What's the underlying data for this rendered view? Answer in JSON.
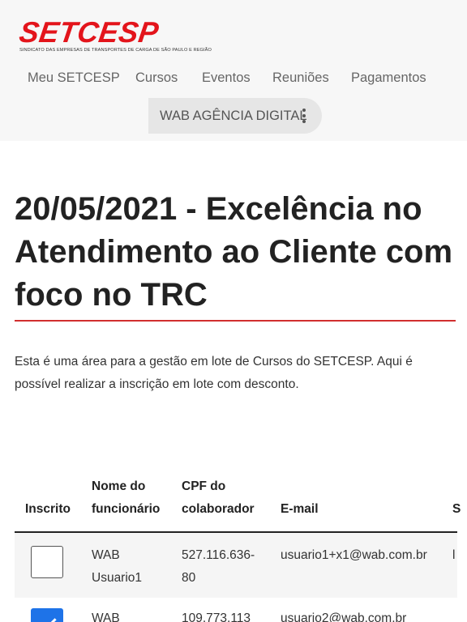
{
  "header": {
    "logo_text": "SETCESP",
    "logo_tagline": "SINDICATO DAS EMPRESAS DE TRANSPORTES DE CARGA DE SÃO PAULO E REGIÃO",
    "nav": [
      "Meu SETCESP",
      "Cursos",
      "Eventos",
      "Reuniões",
      "Pagamentos"
    ],
    "account_label": "WAB AGÊNCIA DIGITAL",
    "account_menu_icon": "kebab-vertical-icon",
    "brand_color": "#e3141b"
  },
  "page": {
    "title": "20/05/2021 - Excelência no Atendimento ao Cliente com foco no TRC",
    "intro": "Esta é uma área para a gestão em lote de Cursos do SETCESP. Aqui é possível realizar a inscrição em lote com desconto."
  },
  "table": {
    "headers": [
      "Inscrito",
      "Nome do funcionário",
      "CPF do colaborador",
      "E-mail",
      "S"
    ],
    "rows": [
      {
        "inscrito": false,
        "nome": "WAB Usuario1",
        "cpf": "527.116.636-80",
        "email": "usuario1+x1@wab.com.br",
        "extra": "l"
      },
      {
        "inscrito": true,
        "nome": "WAB",
        "cpf": "109.773.113",
        "email": "usuario2@wab.com.br",
        "extra": ""
      }
    ],
    "accent_color": "#1e73e8"
  }
}
